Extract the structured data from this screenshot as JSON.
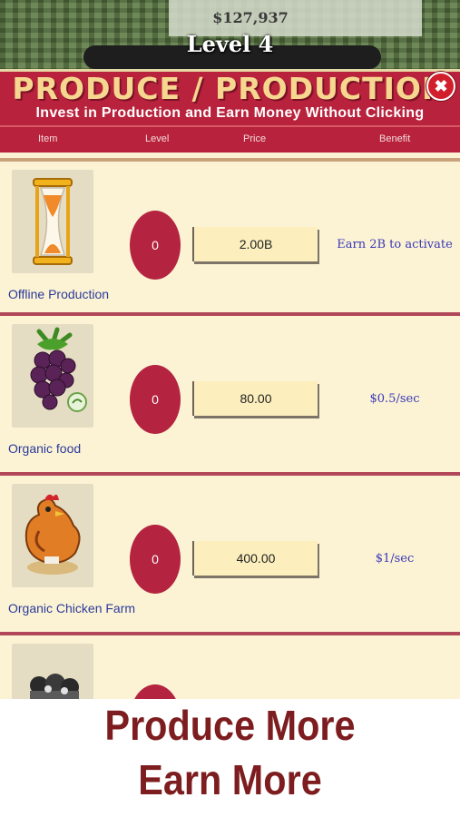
{
  "hud": {
    "money": "$127,937",
    "level": "Level 4"
  },
  "panel": {
    "title": "PRODUCE / PRODUCTION",
    "subtitle": "Invest in Production and Earn Money Without Clicking",
    "close_icon": "close-icon",
    "columns": {
      "item": "Item",
      "level": "Level",
      "price": "Price",
      "benefit": "Benefit"
    }
  },
  "items": [
    {
      "name": "Offline Production",
      "level": "0",
      "price": "2.00B",
      "benefit": "Earn 2B to activate",
      "icon": "hourglass-icon"
    },
    {
      "name": "Organic food",
      "level": "0",
      "price": "80.00",
      "benefit": "$0.5/sec",
      "icon": "blackberry-icon"
    },
    {
      "name": "Organic Chicken Farm",
      "level": "0",
      "price": "400.00",
      "benefit": "$1/sec",
      "icon": "chicken-icon"
    },
    {
      "name": "",
      "level": "",
      "price": "",
      "benefit": "",
      "icon": "cows-icon"
    }
  ],
  "promo": {
    "line1": "Produce More",
    "line2": "Earn More"
  },
  "colors": {
    "panel_red": "#b8223c",
    "title_gold": "#f6d78f",
    "list_cream": "#fbf3d4",
    "benefit_blue": "#3b37b8",
    "promo_text": "#7d1d1f"
  }
}
